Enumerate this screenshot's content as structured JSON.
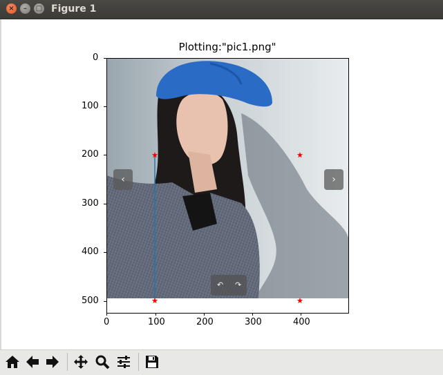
{
  "window": {
    "title": "Figure 1",
    "close_glyph": "×",
    "minimize_glyph": "–",
    "maximize_glyph": "□"
  },
  "plot": {
    "title": "Plotting:\"pic1.png\"",
    "y_ticks": [
      "0",
      "100",
      "200",
      "300",
      "400",
      "500"
    ],
    "x_ticks": [
      "0",
      "100",
      "200",
      "300",
      "400"
    ],
    "photo_prev_glyph": "‹",
    "photo_next_glyph": "›",
    "rotate_left_glyph": "↶",
    "rotate_right_glyph": "↷"
  },
  "chart_data": {
    "type": "scatter",
    "title": "Plotting:\"pic1.png\"",
    "xlim": [
      0,
      500
    ],
    "ylim": [
      525,
      0
    ],
    "image_extent_y": [
      0,
      498
    ],
    "points": [
      {
        "x": 100,
        "y": 200
      },
      {
        "x": 100,
        "y": 500
      },
      {
        "x": 400,
        "y": 200
      },
      {
        "x": 400,
        "y": 500
      }
    ],
    "point_marker": "*",
    "point_color": "#ff0000",
    "line": {
      "x": [
        100,
        100
      ],
      "y": [
        200,
        500
      ],
      "color": "#1f77b4"
    }
  },
  "toolbar": {
    "buttons": [
      {
        "name": "home-button",
        "icon": "home-icon"
      },
      {
        "name": "back-button",
        "icon": "arrow-left-icon"
      },
      {
        "name": "forward-button",
        "icon": "arrow-right-icon"
      },
      {
        "name": "pan-button",
        "icon": "move-icon"
      },
      {
        "name": "zoom-button",
        "icon": "magnifier-icon"
      },
      {
        "name": "configure-subplots-button",
        "icon": "sliders-icon"
      },
      {
        "name": "save-button",
        "icon": "floppy-disk-icon"
      }
    ]
  }
}
